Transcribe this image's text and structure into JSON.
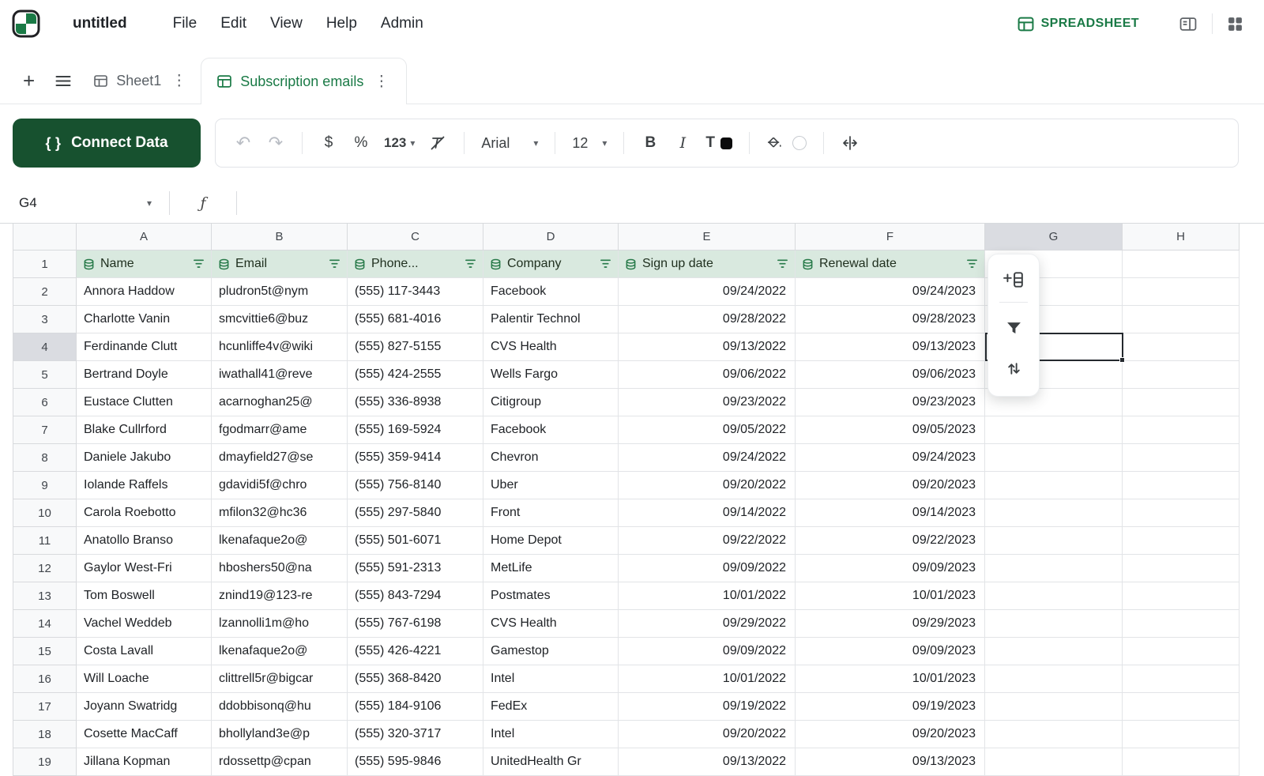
{
  "app": {
    "title": "untitled",
    "menu": [
      "File",
      "Edit",
      "View",
      "Help",
      "Admin"
    ],
    "mode_label": "SPREADSHEET"
  },
  "tabs": {
    "sheet1_label": "Sheet1",
    "active_label": "Subscription emails"
  },
  "toolbar": {
    "connect_data_label": "Connect Data",
    "currency_label": "$",
    "percent_label": "%",
    "number_format_label": "123",
    "font_family_value": "Arial",
    "font_size_value": "12",
    "bold_label": "B",
    "italic_label": "I",
    "text_color_label": "T"
  },
  "formula_bar": {
    "cell_ref": "G4",
    "fx_label": "ƒ"
  },
  "colors": {
    "brand_green": "#1a7a46",
    "button_green": "#17512f",
    "header_cell_green": "#d9e9df",
    "selection_border": "#24292e"
  },
  "grid": {
    "column_letters": [
      "A",
      "B",
      "C",
      "D",
      "E",
      "F",
      "G",
      "H"
    ],
    "selection": {
      "column": "G",
      "row": 4
    },
    "columns": [
      {
        "label": "Name"
      },
      {
        "label": "Email"
      },
      {
        "label": "Phone..."
      },
      {
        "label": "Company"
      },
      {
        "label": "Sign up date",
        "align": "right"
      },
      {
        "label": "Renewal date",
        "align": "right"
      }
    ],
    "rows": [
      [
        "Annora Haddow",
        "pludron5t@nym",
        "(555) 117-3443",
        "Facebook",
        "09/24/2022",
        "09/24/2023"
      ],
      [
        "Charlotte Vanin",
        "smcvittie6@buz",
        "(555) 681-4016",
        "Palentir Technol",
        "09/28/2022",
        "09/28/2023"
      ],
      [
        "Ferdinande Clutt",
        "hcunliffe4v@wiki",
        "(555) 827-5155",
        "CVS Health",
        "09/13/2022",
        "09/13/2023"
      ],
      [
        "Bertrand Doyle",
        "iwathall41@reve",
        "(555) 424-2555",
        "Wells Fargo",
        "09/06/2022",
        "09/06/2023"
      ],
      [
        "Eustace Clutten",
        "acarnoghan25@",
        "(555) 336-8938",
        "Citigroup",
        "09/23/2022",
        "09/23/2023"
      ],
      [
        "Blake Cullrford",
        "fgodmarr@ame",
        "(555) 169-5924",
        "Facebook",
        "09/05/2022",
        "09/05/2023"
      ],
      [
        "Daniele Jakubo",
        "dmayfield27@se",
        "(555) 359-9414",
        "Chevron",
        "09/24/2022",
        "09/24/2023"
      ],
      [
        "Iolande Raffels",
        "gdavidi5f@chro",
        "(555) 756-8140",
        "Uber",
        "09/20/2022",
        "09/20/2023"
      ],
      [
        "Carola Roebotto",
        "mfilon32@hc36",
        "(555) 297-5840",
        "Front",
        "09/14/2022",
        "09/14/2023"
      ],
      [
        "Anatollo Branso",
        "lkenafaque2o@",
        "(555) 501-6071",
        "Home Depot",
        "09/22/2022",
        "09/22/2023"
      ],
      [
        "Gaylor West-Fri",
        "hboshers50@na",
        "(555) 591-2313",
        "MetLife",
        "09/09/2022",
        "09/09/2023"
      ],
      [
        "Tom Boswell",
        "znind19@123-re",
        "(555) 843-7294",
        "Postmates",
        "10/01/2022",
        "10/01/2023"
      ],
      [
        "Vachel Weddeb",
        "lzannolli1m@ho",
        "(555) 767-6198",
        "CVS Health",
        "09/29/2022",
        "09/29/2023"
      ],
      [
        "Costa Lavall",
        "lkenafaque2o@",
        "(555) 426-4221",
        "Gamestop",
        "09/09/2022",
        "09/09/2023"
      ],
      [
        "Will Loache",
        "clittrell5r@bigcar",
        "(555) 368-8420",
        "Intel",
        "10/01/2022",
        "10/01/2023"
      ],
      [
        "Joyann Swatridg",
        "ddobbisonq@hu",
        "(555) 184-9106",
        "FedEx",
        "09/19/2022",
        "09/19/2023"
      ],
      [
        "Cosette MacCaff",
        "bhollyland3e@p",
        "(555) 320-3717",
        "Intel",
        "09/20/2022",
        "09/20/2023"
      ],
      [
        "Jillana Kopman",
        "rdossettp@cpan",
        "(555) 595-9846",
        "UnitedHealth Gr",
        "09/13/2022",
        "09/13/2023"
      ]
    ]
  }
}
